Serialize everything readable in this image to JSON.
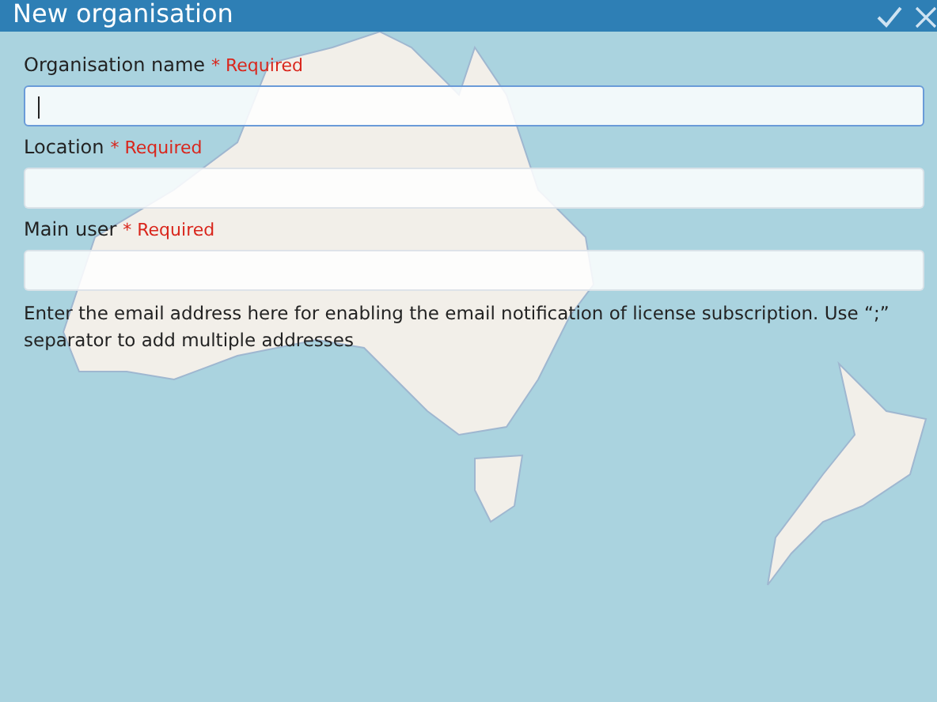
{
  "window": {
    "title": "New organisation"
  },
  "fields": [
    {
      "label": "Organisation name",
      "required": "* Required",
      "focused": true
    },
    {
      "label": "Location",
      "required": "* Required",
      "focused": false
    },
    {
      "label": "Main user",
      "required": "* Required",
      "focused": false
    }
  ],
  "help_text": "Enter the email address here for enabling the email notification of license subscription. Use “;” separator to add multiple addresses"
}
